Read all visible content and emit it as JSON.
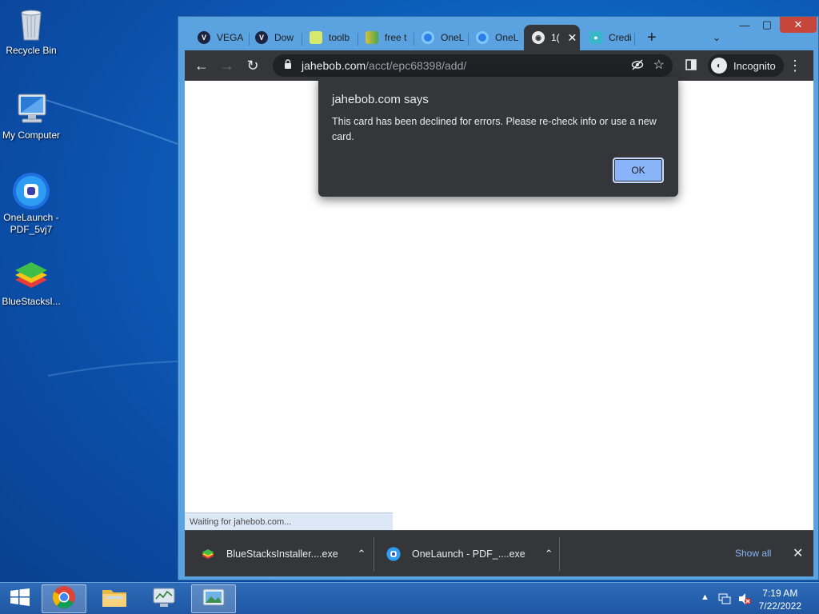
{
  "desktop": {
    "icons": [
      {
        "label": "Recycle Bin"
      },
      {
        "label": "My Computer"
      },
      {
        "label": "OneLaunch - PDF_5vj7"
      },
      {
        "label": "BlueStacksI..."
      }
    ]
  },
  "browser": {
    "tabs": [
      {
        "label": "VEGA",
        "icon": "v-logo-icon"
      },
      {
        "label": "Dow",
        "icon": "v-logo-icon"
      },
      {
        "label": "toolb",
        "icon": "leaf-icon"
      },
      {
        "label": "free t",
        "icon": "leaf-icon"
      },
      {
        "label": "OneL",
        "icon": "onelaunch-icon"
      },
      {
        "label": "OneL",
        "icon": "onelaunch-icon"
      },
      {
        "label": "1(",
        "icon": "globe-icon",
        "active": true
      },
      {
        "label": "Credi",
        "icon": "person-icon"
      }
    ],
    "new_tab_symbol": "+",
    "url_domain": "jahebob.com",
    "url_path": "/acct/epc68398/add/",
    "incognito_label": "Incognito",
    "status_text": "Waiting for jahebob.com..."
  },
  "dialog": {
    "title": "jahebob.com says",
    "message": "This card has been declined for errors. Please re-check info or use a new card.",
    "ok_label": "OK"
  },
  "downloads": {
    "items": [
      {
        "label": "BlueStacksInstaller....exe"
      },
      {
        "label": "OneLaunch - PDF_....exe"
      }
    ],
    "show_all_label": "Show all"
  },
  "taskbar": {
    "time": "7:19 AM",
    "date": "7/22/2022"
  },
  "colors": {
    "accent": "#8ab4f8",
    "dark_surface": "#35363a"
  }
}
